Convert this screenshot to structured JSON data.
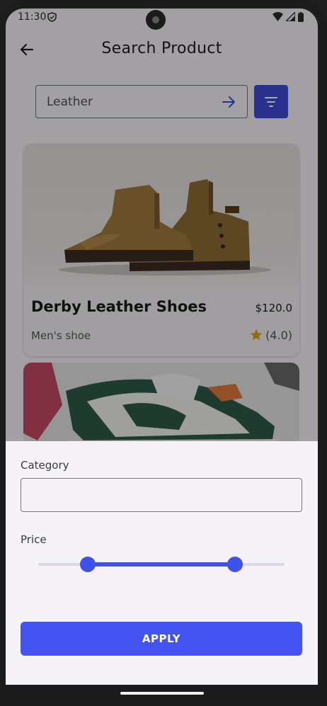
{
  "status_bar": {
    "time": "11:30"
  },
  "app_bar": {
    "title": "Search Product",
    "back_icon": "arrow-left-icon"
  },
  "search": {
    "value": "Leather",
    "submit_icon": "arrow-right-icon",
    "filter_icon": "filter-icon"
  },
  "products": [
    {
      "name": "Derby Leather Shoes",
      "price": "$120.0",
      "category": "Men's shoe",
      "rating": "(4.0)",
      "rating_value": 4.0,
      "image": "brown-leather-boot-image"
    },
    {
      "image": "green-sneaker-image"
    }
  ],
  "filter_sheet": {
    "category_label": "Category",
    "category_value": "",
    "price_label": "Price",
    "price_range": {
      "low": 0.2,
      "high": 0.8
    },
    "apply_label": "APPLY"
  },
  "colors": {
    "accent": "#4354f2",
    "filter_button": "#3e4bd6",
    "star": "#e0a319"
  }
}
